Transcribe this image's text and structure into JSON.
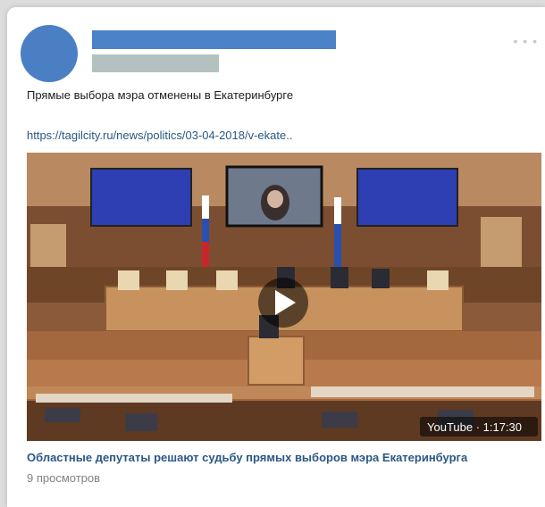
{
  "post": {
    "text": "Прямые выбора мэра отменены в Екатеринбурге",
    "link": "https://tagilcity.ru/news/politics/03-04-2018/v-ekate..",
    "more_icon": "more-dots-icon"
  },
  "video": {
    "source_and_duration": "YouTube · 1:17:30",
    "title": "Областные депутаты решают судьбу прямых выборов мэра Екатеринбурга",
    "views": "9 просмотров",
    "play_icon": "play-icon"
  },
  "colors": {
    "avatar": "#4a7fc4",
    "name_placeholder": "#4b82c8",
    "date_placeholder": "#b3c1c1",
    "link": "#2a5885",
    "text": "#1e1e1e",
    "muted": "#828282"
  }
}
